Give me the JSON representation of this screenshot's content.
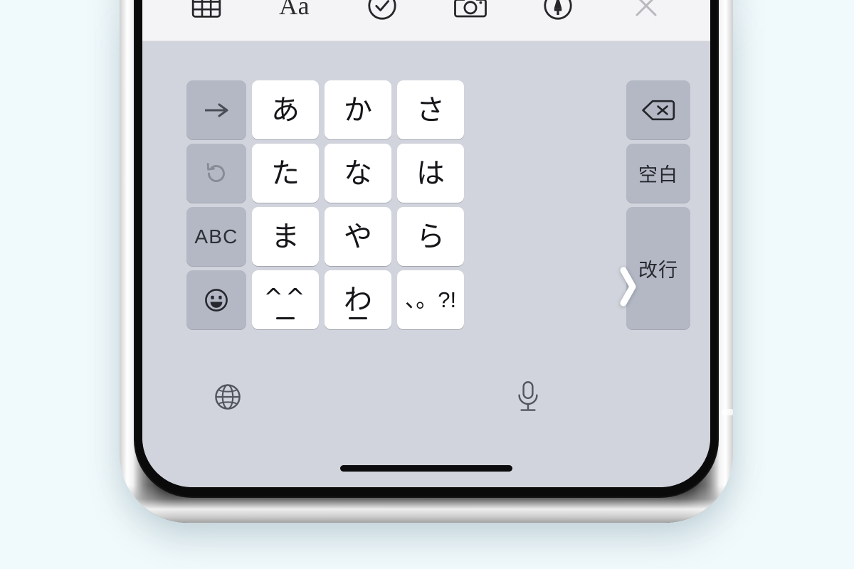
{
  "background_color": "#f0f9fb",
  "device": {
    "frame_color": "#c9c9c9",
    "bezel_color": "#0a0a0a",
    "screen_color": "#f6f6f8"
  },
  "toolbar": {
    "background": "#f4f4f7",
    "items": [
      {
        "name": "table-icon",
        "label": "",
        "icon": "table-icon"
      },
      {
        "name": "text-format-button",
        "label": "Aa",
        "icon": "text-format-icon"
      },
      {
        "name": "checklist-icon",
        "label": "",
        "icon": "check-circle-icon"
      },
      {
        "name": "camera-icon",
        "label": "",
        "icon": "camera-icon"
      },
      {
        "name": "markup-icon",
        "label": "",
        "icon": "markup-pen-icon"
      },
      {
        "name": "close-icon",
        "label": "",
        "icon": "close-x-icon"
      }
    ]
  },
  "keyboard": {
    "background": "#d1d4dc",
    "letter_key_color": "#ffffff",
    "function_key_color": "#b3b8c4",
    "rows": [
      [
        {
          "label": "→",
          "type": "func",
          "name": "key-arrow-right"
        },
        {
          "label": "あ",
          "type": "letter",
          "name": "key-a"
        },
        {
          "label": "か",
          "type": "letter",
          "name": "key-ka"
        },
        {
          "label": "さ",
          "type": "letter",
          "name": "key-sa"
        }
      ],
      [
        {
          "label": "↺",
          "type": "func-dim",
          "name": "key-undo"
        },
        {
          "label": "た",
          "type": "letter",
          "name": "key-ta"
        },
        {
          "label": "な",
          "type": "letter",
          "name": "key-na"
        },
        {
          "label": "は",
          "type": "letter",
          "name": "key-ha"
        }
      ],
      [
        {
          "label": "ABC",
          "type": "func",
          "name": "key-abc"
        },
        {
          "label": "ま",
          "type": "letter",
          "name": "key-ma"
        },
        {
          "label": "や",
          "type": "letter",
          "name": "key-ya"
        },
        {
          "label": "ら",
          "type": "letter",
          "name": "key-ra"
        }
      ],
      [
        {
          "label": "",
          "type": "func-emoji",
          "name": "key-emoji"
        },
        {
          "label": "^^",
          "type": "letter-kaomoji",
          "name": "key-kaomoji"
        },
        {
          "label": "わ",
          "type": "letter-underscore",
          "name": "key-wa"
        },
        {
          "label": "、。?!",
          "type": "letter-punct",
          "name": "key-punctuation"
        }
      ]
    ],
    "right_column": [
      {
        "label": "",
        "type": "func",
        "name": "key-delete",
        "icon": "delete-backspace-icon"
      },
      {
        "label": "空白",
        "type": "func",
        "name": "key-space"
      },
      {
        "label": "改行",
        "type": "func",
        "name": "key-return"
      }
    ],
    "bottom_bar": {
      "globe": "globe-icon",
      "mic": "microphone-icon"
    }
  },
  "overlay": {
    "next_chevron": "›"
  }
}
